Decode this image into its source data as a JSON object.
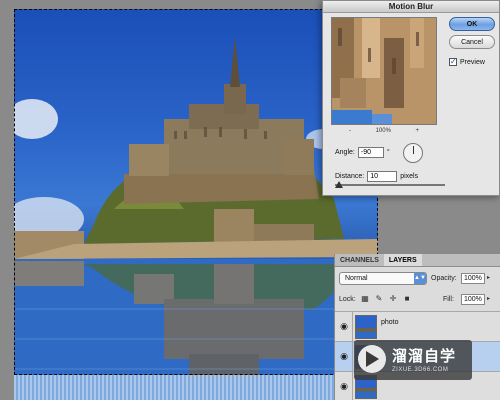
{
  "dialog": {
    "title": "Motion Blur",
    "ok_label": "OK",
    "cancel_label": "Cancel",
    "preview_label": "Preview",
    "preview_checked": true,
    "zoom_out": "-",
    "zoom_level": "100%",
    "zoom_in": "+",
    "angle_label": "Angle:",
    "angle_value": "-90",
    "angle_unit": "°",
    "distance_label": "Distance:",
    "distance_value": "10",
    "distance_unit": "pixels"
  },
  "layers_panel": {
    "tabs": [
      "CHANNELS",
      "LAYERS"
    ],
    "active_tab": "LAYERS",
    "blend_mode": "Normal",
    "opacity_label": "Opacity:",
    "opacity_value": "100%",
    "lock_label": "Lock:",
    "fill_label": "Fill:",
    "fill_value": "100%",
    "layers": [
      {
        "name": "photo",
        "selected": false
      },
      {
        "name": "",
        "selected": true
      },
      {
        "name": "",
        "selected": false
      }
    ]
  },
  "watermark": {
    "brand": "溜溜自学",
    "url": "ZIXUE.3D66.COM"
  },
  "icons": {
    "eye": "eye-icon",
    "lock_transparent": "lock-transparent-icon",
    "lock_brush": "brush-icon",
    "lock_move": "move-icon",
    "lock_all": "lock-icon",
    "dropdown": "chevron-down-icon"
  },
  "colors": {
    "sky": "#2a63c7",
    "ok_button": "#6d9fe0",
    "panel_bg": "#dcdcdc",
    "selected_layer": "#b8d0f0"
  }
}
